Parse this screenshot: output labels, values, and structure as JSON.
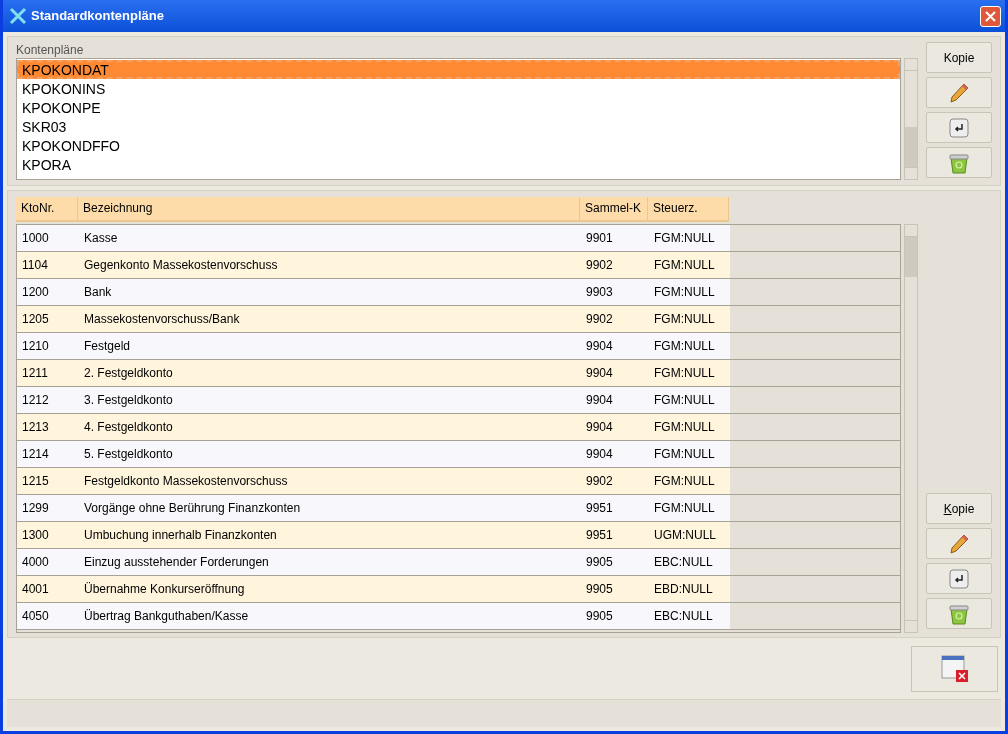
{
  "window": {
    "title": "Standardkontenpläne"
  },
  "plans": {
    "label": "Kontenpläne",
    "items": [
      {
        "name": "KPOKONDAT",
        "selected": true
      },
      {
        "name": "KPOKONINS",
        "selected": false
      },
      {
        "name": "KPOKONPE",
        "selected": false
      },
      {
        "name": "SKR03",
        "selected": false
      },
      {
        "name": "KPOKONDFFO",
        "selected": false
      },
      {
        "name": "KPORA",
        "selected": false
      }
    ],
    "buttons": [
      {
        "kind": "text",
        "label": "Kopie",
        "mnemonic": false
      },
      {
        "kind": "edit"
      },
      {
        "kind": "enter"
      },
      {
        "kind": "delete"
      }
    ]
  },
  "accounts": {
    "columns": [
      "KtoNr.",
      "Bezeichnung",
      "Sammel-K",
      "Steuerz."
    ],
    "rows": [
      [
        "1000",
        "Kasse",
        "9901",
        "FGM:NULL"
      ],
      [
        "1104",
        "Gegenkonto Massekostenvorschuss",
        "9902",
        "FGM:NULL"
      ],
      [
        "1200",
        "Bank",
        "9903",
        "FGM:NULL"
      ],
      [
        "1205",
        "Massekostenvorschuss/Bank",
        "9902",
        "FGM:NULL"
      ],
      [
        "1210",
        "Festgeld",
        "9904",
        "FGM:NULL"
      ],
      [
        "1211",
        "2. Festgeldkonto",
        "9904",
        "FGM:NULL"
      ],
      [
        "1212",
        "3. Festgeldkonto",
        "9904",
        "FGM:NULL"
      ],
      [
        "1213",
        "4. Festgeldkonto",
        "9904",
        "FGM:NULL"
      ],
      [
        "1214",
        "5. Festgeldkonto",
        "9904",
        "FGM:NULL"
      ],
      [
        "1215",
        "Festgeldkonto Massekostenvorschuss",
        "9902",
        "FGM:NULL"
      ],
      [
        "1299",
        "Vorgänge ohne Berührung Finanzkonten",
        "9951",
        "FGM:NULL"
      ],
      [
        "1300",
        "Umbuchung innerhalb Finanzkonten",
        "9951",
        "UGM:NULL"
      ],
      [
        "4000",
        "Einzug ausstehender Forderungen",
        "9905",
        "EBC:NULL"
      ],
      [
        "4001",
        "Übernahme Konkurseröffnung",
        "9905",
        "EBD:NULL"
      ],
      [
        "4050",
        "Übertrag Bankguthaben/Kasse",
        "9905",
        "EBC:NULL"
      ]
    ],
    "buttons": [
      {
        "kind": "text",
        "label": "Kopie",
        "mnemonic": true
      },
      {
        "kind": "edit"
      },
      {
        "kind": "enter"
      },
      {
        "kind": "delete"
      }
    ]
  }
}
